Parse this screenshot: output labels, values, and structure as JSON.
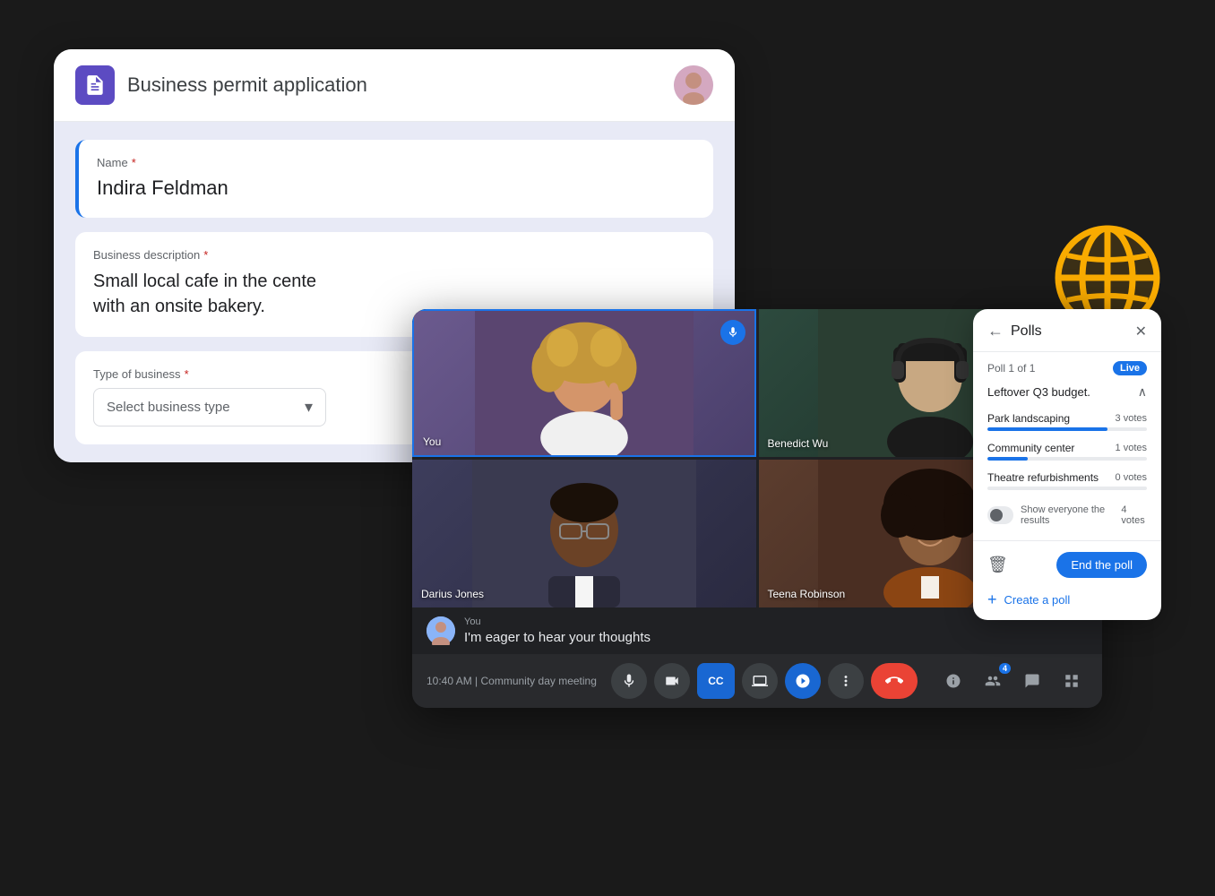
{
  "form": {
    "title": "Business permit application",
    "header_icon": "form-icon",
    "fields": {
      "name": {
        "label": "Name",
        "required": true,
        "value": "Indira Feldman"
      },
      "business_description": {
        "label": "Business description",
        "required": true,
        "value": "Small local cafe in the cente\nwith an onsite bakery."
      },
      "type_of_business": {
        "label": "Type of business",
        "required": true,
        "placeholder": "Select business type"
      }
    }
  },
  "video": {
    "time": "10:40 AM",
    "meeting_name": "Community day meeting",
    "participants": [
      {
        "name": "You",
        "label": "You"
      },
      {
        "name": "Benedict Wu",
        "label": "Benedict Wu"
      },
      {
        "name": "Darius Jones",
        "label": "Darius Jones"
      },
      {
        "name": "Teena Robinson",
        "label": "Teena Robinson"
      }
    ],
    "chat": {
      "sender": "You",
      "message": "I'm eager to hear your thoughts"
    },
    "controls": {
      "mic": "mic",
      "camera": "camera",
      "cc": "CC",
      "present": "present",
      "activities": "activities",
      "more": "more",
      "end_call": "end call",
      "info": "info",
      "people_count": "4",
      "chat": "chat",
      "more_options": "more"
    }
  },
  "polls": {
    "title": "Polls",
    "counter": "Poll 1 of 1",
    "live_label": "Live",
    "question": "Leftover Q3 budget.",
    "options": [
      {
        "label": "Park landscaping",
        "votes": 3,
        "votes_label": "3 votes",
        "percent": 75
      },
      {
        "label": "Community center",
        "votes": 1,
        "votes_label": "1 votes",
        "percent": 25
      },
      {
        "label": "Theatre refurbishments",
        "votes": 0,
        "votes_label": "0 votes",
        "percent": 0
      }
    ],
    "show_results": {
      "label": "Show everyone the results",
      "votes": "4 votes"
    },
    "end_poll_label": "End the poll",
    "create_poll_label": "Create a poll"
  },
  "globe": {
    "color": "#f9ab00",
    "accent": "#fbbc04"
  }
}
